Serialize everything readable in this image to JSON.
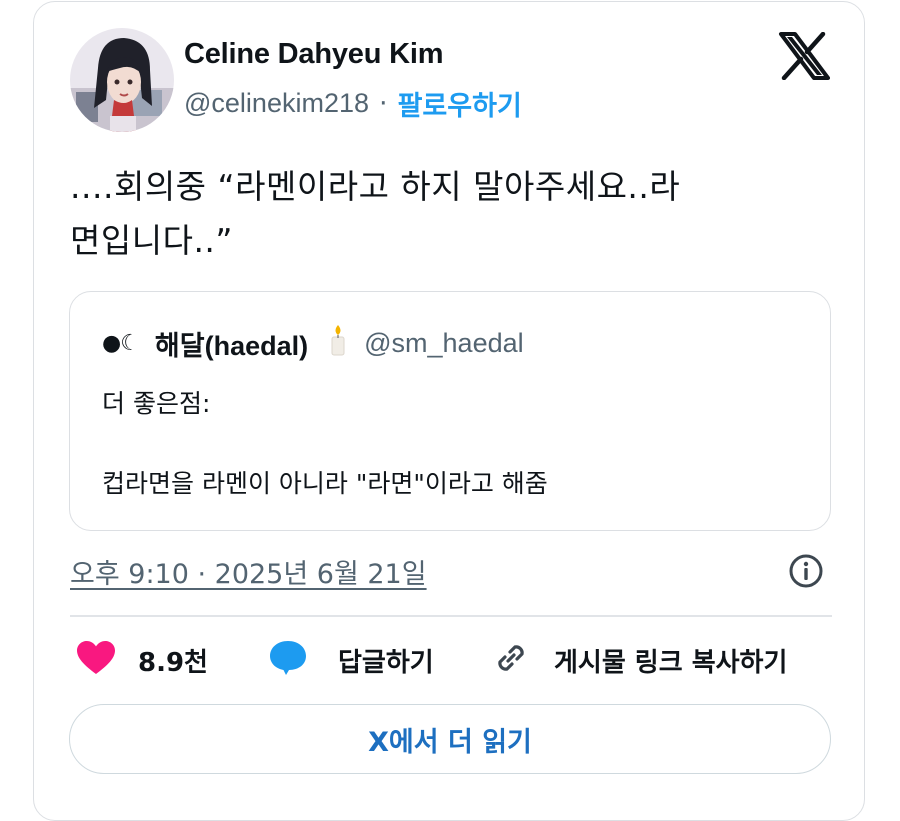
{
  "tweet": {
    "author": {
      "display_name": "Celine Dahyeu Kim",
      "handle": "@celinekim218",
      "separator": "·",
      "follow_label": "팔로우하기",
      "avatar_icon": "avatar-illustration"
    },
    "brand_icon": "x-logo-icon",
    "text_line1": "....회의중 “라멘이라고 하지 말아주세요..라",
    "text_line2": "면입니다..”",
    "quoted": {
      "prefix_icon": "moon-phase-icon",
      "prefix_glyph": "●☾",
      "display_name": "해달(haedal)",
      "badge_icon": "candle-icon",
      "handle": "@sm_haedal",
      "line1": "더 좋은점:",
      "line2": "컵라면을 라멘이 아니라 \"라면\"이라고 해줌"
    },
    "timestamp": "오후 9:10 · 2025년 6월 21일",
    "info_icon": "info-icon",
    "actions": {
      "like_count": "8.9천",
      "reply_label": "답글하기",
      "copy_link_label": "게시물 링크 복사하기"
    },
    "read_more_label": "X에서 더 읽기"
  },
  "colors": {
    "accent_blue": "#1d9bf0",
    "like_pink": "#f91880",
    "secondary_text": "#536471",
    "border": "#dcdfe3"
  }
}
